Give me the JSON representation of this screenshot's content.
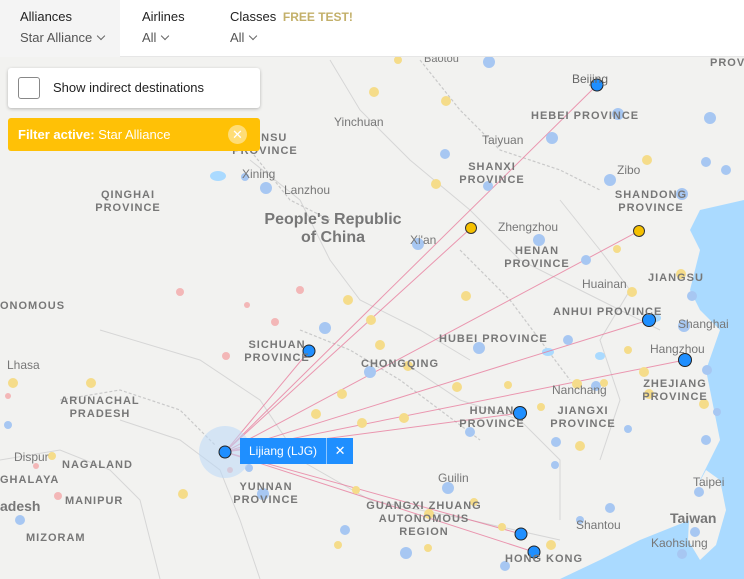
{
  "filters": {
    "alliances": {
      "label": "Alliances",
      "value": "Star Alliance"
    },
    "airlines": {
      "label": "Airlines",
      "value": "All"
    },
    "classes": {
      "label": "Classes",
      "value": "All",
      "badge": "FREE TEST!"
    }
  },
  "indirect": {
    "label": "Show indirect destinations",
    "checked": false
  },
  "active_filter": {
    "prefix": "Filter active:",
    "value": "Star Alliance"
  },
  "origin": {
    "name": "Lijiang (LJG)"
  },
  "map_labels": {
    "baotou": "Baotou",
    "beijing": "Beijing",
    "hebei": "HEBEI PROVINCE",
    "prov": "PROV",
    "yinchuan": "Yinchuan",
    "taiyuan": "Taiyuan",
    "gansu": "GANSU PROVINCE",
    "shanxi": "SHANXI PROVINCE",
    "zibo": "Zibo",
    "xining": "Xining",
    "lanzhou": "Lanzhou",
    "shandong": "SHANDONG PROVINCE",
    "qinghai": "QINGHAI PROVINCE",
    "prc": "People's Republic of China",
    "zhengzhou": "Zhengzhou",
    "xian": "Xi'an",
    "henan": "HENAN PROVINCE",
    "jiangsu": "JIANGSU",
    "huainan": "Huainan",
    "anhui": "ANHUI PROVINCE",
    "autonomous": "ONOMOUS",
    "hubei": "HUBEI PROVINCE",
    "shanghai": "Shanghai",
    "sichuan": "SICHUAN PROVINCE",
    "chongqing": "CHONGQING",
    "hangzhou": "Hangzhou",
    "lhasa": "Lhasa",
    "zhejiang": "ZHEJIANG PROVINCE",
    "nanchang": "Nanchang",
    "arunachal": "ARUNACHAL PRADESH",
    "hunan": "HUNAN PROVINCE",
    "jiangxi": "JIANGXI PROVINCE",
    "dispur": "Dispur",
    "nagaland": "NAGALAND",
    "yunnan": "YUNNAN PROVINCE",
    "guilin": "Guilin",
    "ghalaya": "GHALAYA",
    "taipei": "Taipei",
    "manipur": "MANIPUR",
    "guangxi": "GUANGXI ZHUANG AUTONOMOUS REGION",
    "adesh": "adesh",
    "shantou": "Shantou",
    "taiwan": "Taiwan",
    "mizoram": "MIZORAM",
    "hongkong": "HONG KONG",
    "kaohsiung": "Kaohsiung"
  },
  "colors": {
    "route": "#e8789a",
    "destination": "#1f8fff",
    "other_airport": "#f5c000",
    "land": "#f2f2f0",
    "sea": "#aadaff"
  }
}
